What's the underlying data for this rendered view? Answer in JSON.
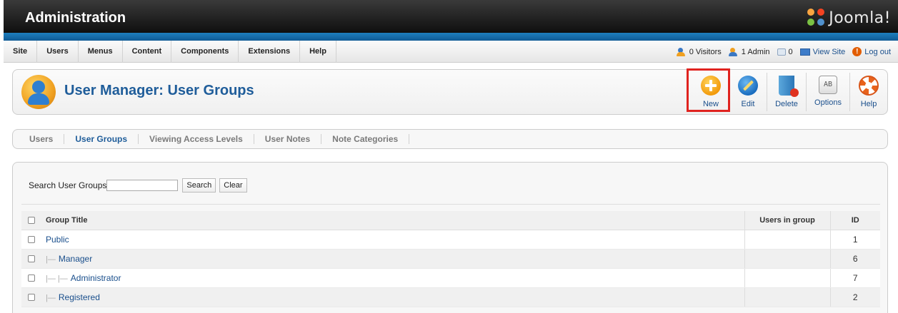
{
  "header": {
    "title": "Administration",
    "brand": "Joomla!",
    "logo_icon": "joomla-logo-icon"
  },
  "menu": {
    "items": [
      "Site",
      "Users",
      "Menus",
      "Content",
      "Components",
      "Extensions",
      "Help"
    ]
  },
  "status": {
    "visitors": "0 Visitors",
    "admins": "1 Admin",
    "messages": "0",
    "view_site": "View Site",
    "logout": "Log out"
  },
  "toolbar": {
    "title": "User Manager: User Groups",
    "title_icon": "user-groups-icon",
    "buttons": [
      {
        "label": "New",
        "icon": "new-icon"
      },
      {
        "label": "Edit",
        "icon": "edit-icon"
      },
      {
        "label": "Delete",
        "icon": "delete-icon"
      },
      {
        "label": "Options",
        "icon": "options-icon"
      },
      {
        "label": "Help",
        "icon": "help-icon"
      }
    ],
    "highlight_color": "#e0231f"
  },
  "submenu": {
    "items": [
      "Users",
      "User Groups",
      "Viewing Access Levels",
      "User Notes",
      "Note Categories"
    ],
    "active": "User Groups"
  },
  "filter": {
    "label": "Search User Groups",
    "value": "",
    "search_label": "Search",
    "clear_label": "Clear"
  },
  "table": {
    "headers": {
      "title": "Group Title",
      "users": "Users in group",
      "id": "ID"
    },
    "rows": [
      {
        "title": "Public",
        "depth": 0,
        "users": "",
        "id": "1"
      },
      {
        "title": "Manager",
        "depth": 1,
        "users": "",
        "id": "6"
      },
      {
        "title": "Administrator",
        "depth": 2,
        "users": "",
        "id": "7"
      },
      {
        "title": "Registered",
        "depth": 1,
        "users": "",
        "id": "2"
      }
    ]
  },
  "colors": {
    "accent": "#1f5d9a",
    "header_bg": "#1a1a1a",
    "strip": "#1e7fbf"
  }
}
